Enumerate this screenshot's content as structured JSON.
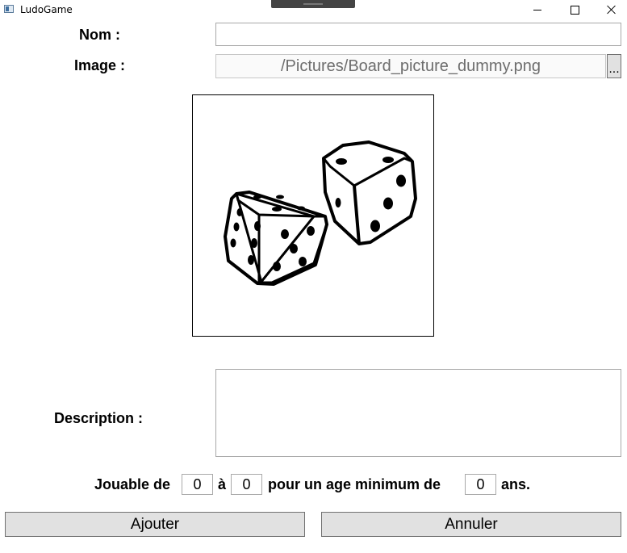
{
  "window": {
    "title": "LudoGame"
  },
  "form": {
    "name_label": "Nom :",
    "name_value": "",
    "image_label": "Image :",
    "image_path": "/Pictures/Board_picture_dummy.png",
    "browse_label": "...",
    "description_label": "Description :",
    "description_value": ""
  },
  "playable": {
    "prefix": "Jouable de",
    "min_players": "0",
    "separator": "à",
    "max_players": "0",
    "age_text": "pour un age minimum de",
    "min_age": "0",
    "suffix": "ans."
  },
  "actions": {
    "add_label": "Ajouter",
    "cancel_label": "Annuler"
  },
  "icons": {
    "preview": "dice-image"
  }
}
